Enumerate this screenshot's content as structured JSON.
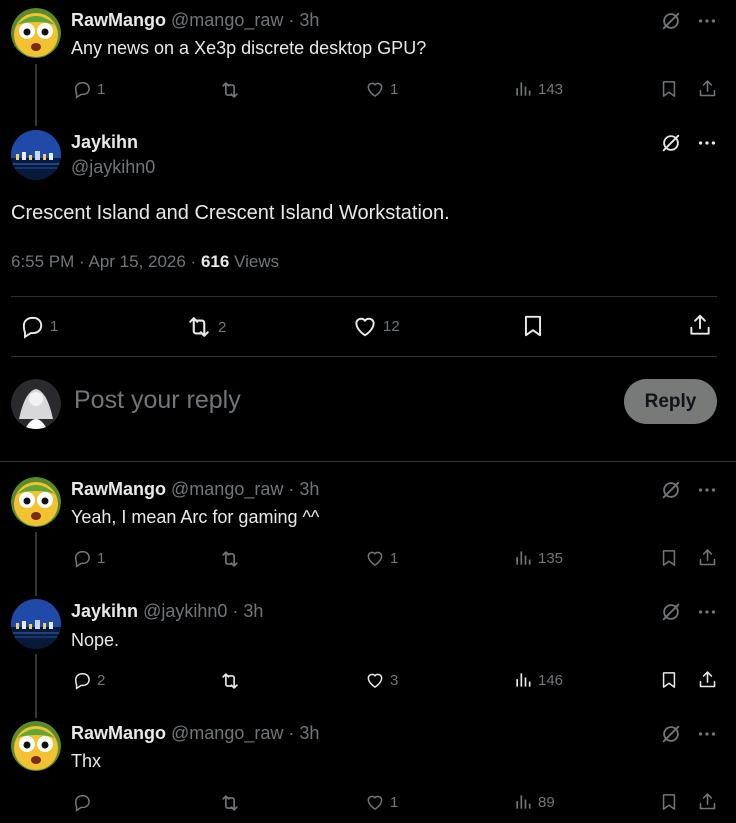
{
  "thread": [
    {
      "name": "RawMango",
      "handle": "@mango_raw",
      "sep": "·",
      "time": "3h",
      "text": "Any news on a Xe3p discrete desktop GPU?",
      "replies": "1",
      "reposts": "",
      "likes": "1",
      "views": "143"
    }
  ],
  "main_post": {
    "name": "Jaykihn",
    "handle": "@jaykihn0",
    "text": "Crescent Island and Crescent Island Workstation.",
    "timestamp": "6:55 PM · Apr 15, 2026 · ",
    "views_count": "616",
    "views_label": "Views",
    "replies": "1",
    "reposts": "2",
    "likes": "12"
  },
  "reply_box": {
    "placeholder": "Post your reply",
    "button_label": "Reply"
  },
  "replies": [
    {
      "name": "RawMango",
      "handle": "@mango_raw",
      "sep": "·",
      "time": "3h",
      "text": "Yeah, I mean Arc for gaming ^^",
      "replies": "1",
      "reposts": "",
      "likes": "1",
      "views": "135"
    },
    {
      "name": "Jaykihn",
      "handle": "@jaykihn0",
      "sep": "·",
      "time": "3h",
      "text": "Nope.",
      "replies": "2",
      "reposts": "",
      "likes": "3",
      "views": "146"
    },
    {
      "name": "RawMango",
      "handle": "@mango_raw",
      "sep": "·",
      "time": "3h",
      "text": "Thx",
      "replies": "",
      "reposts": "",
      "likes": "1",
      "views": "89"
    }
  ],
  "colors": {
    "background": "#000000",
    "text_primary": "#e7e9ea",
    "text_secondary": "#71767b",
    "divider": "#2f3336",
    "reply_button_bg": "#787a7a"
  },
  "icons": [
    "grok-icon",
    "more-icon",
    "reply-icon",
    "repost-icon",
    "like-icon",
    "views-icon",
    "bookmark-icon",
    "share-icon"
  ]
}
